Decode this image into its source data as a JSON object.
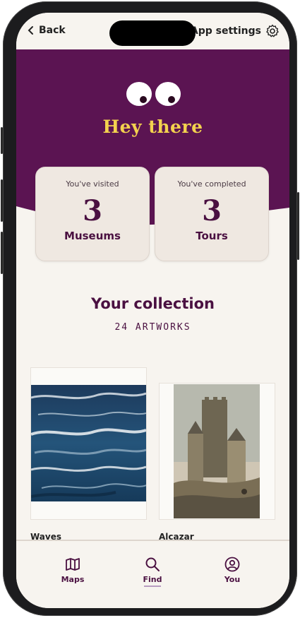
{
  "header": {
    "back_label": "Back",
    "settings_label": "App settings"
  },
  "hero": {
    "greeting": "Hey there",
    "background_color": "#5b1452",
    "greeting_color": "#f3d24e"
  },
  "stats": [
    {
      "label": "You've visited",
      "value": "3",
      "unit": "Museums"
    },
    {
      "label": "You've completed",
      "value": "3",
      "unit": "Tours"
    }
  ],
  "collection": {
    "title": "Your collection",
    "count_label": "24 ARTWORKS",
    "artworks": [
      {
        "title": "Waves",
        "image": "abstract-sea-painting"
      },
      {
        "title": "Alcazar",
        "image": "castle-watercolor-painting"
      }
    ]
  },
  "tabbar": {
    "items": [
      {
        "label": "Maps",
        "icon": "map-icon"
      },
      {
        "label": "Find",
        "icon": "search-icon",
        "active": true
      },
      {
        "label": "You",
        "icon": "profile-icon"
      }
    ]
  }
}
